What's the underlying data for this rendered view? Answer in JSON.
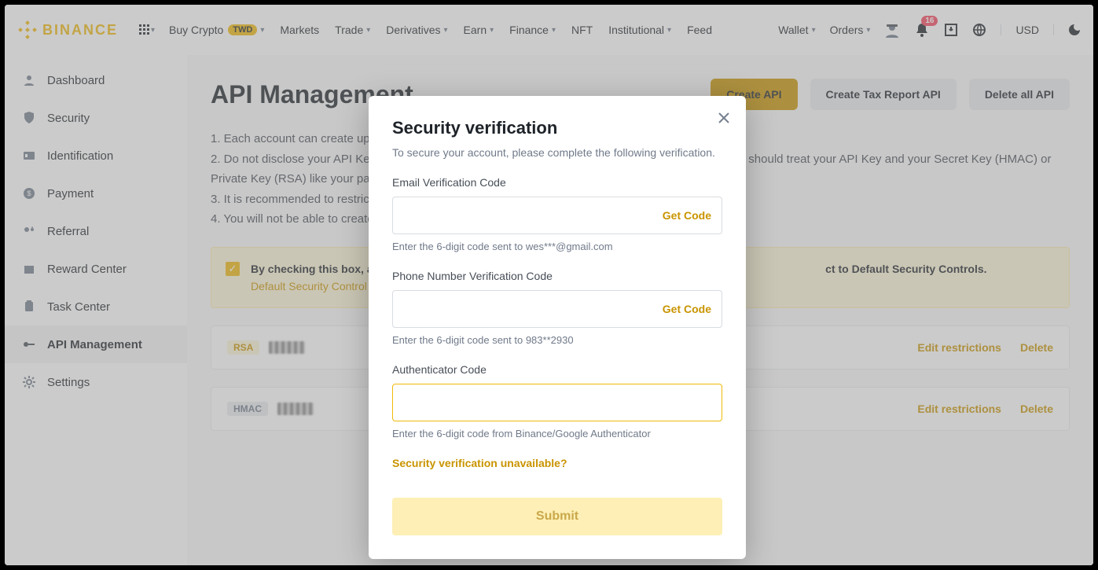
{
  "logo_text": "BINANCE",
  "nav": {
    "buy_crypto": "Buy Crypto",
    "buy_crypto_pill": "TWD",
    "markets": "Markets",
    "trade": "Trade",
    "derivatives": "Derivatives",
    "earn": "Earn",
    "finance": "Finance",
    "nft": "NFT",
    "institutional": "Institutional",
    "feed": "Feed",
    "wallet": "Wallet",
    "orders": "Orders",
    "notif_badge": "16",
    "currency": "USD"
  },
  "sidebar": {
    "items": [
      {
        "label": "Dashboard"
      },
      {
        "label": "Security"
      },
      {
        "label": "Identification"
      },
      {
        "label": "Payment"
      },
      {
        "label": "Referral"
      },
      {
        "label": "Reward Center"
      },
      {
        "label": "Task Center"
      },
      {
        "label": "API Management"
      },
      {
        "label": "Settings"
      }
    ]
  },
  "main": {
    "title": "API Management",
    "btn_create": "Create API",
    "btn_tax": "Create Tax Report API",
    "btn_delete": "Delete all API",
    "notes": {
      "n1": "1. Each account can create up t",
      "n2a": "2. Do not disclose your API Key",
      "n2b": "should treat your API Key and your Secret Key (HMAC) or Private Key (RSA) like your passwords.",
      "n3": "3. It is recommended to restric",
      "n4": "4. You will not be able to create"
    },
    "alert": {
      "text_a": "By checking this box, all",
      "text_b": "ct to Default Security Controls.",
      "link": "Default Security Control"
    },
    "rows": [
      {
        "badge": "RSA",
        "edit": "Edit restrictions",
        "del": "Delete"
      },
      {
        "badge": "HMAC",
        "edit": "Edit restrictions",
        "del": "Delete"
      }
    ]
  },
  "modal": {
    "title": "Security verification",
    "subtitle": "To secure your account, please complete the following verification.",
    "email_label": "Email Verification Code",
    "email_hint": "Enter the 6-digit code sent to wes***@gmail.com",
    "phone_label": "Phone Number Verification Code",
    "phone_hint": "Enter the 6-digit code sent to 983**2930",
    "auth_label": "Authenticator Code",
    "auth_hint": "Enter the 6-digit code from Binance/Google Authenticator",
    "getcode": "Get Code",
    "help_link": "Security verification unavailable?",
    "submit": "Submit"
  }
}
